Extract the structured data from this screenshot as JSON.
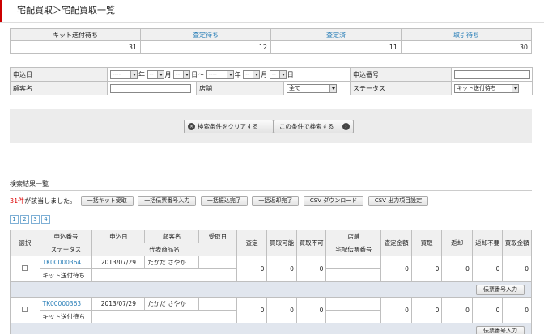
{
  "header": {
    "title": "宅配買取＞宅配買取一覧"
  },
  "summary": {
    "headers": [
      "キット送付待ち",
      "査定待ち",
      "査定済",
      "取引待ち"
    ],
    "counts": [
      "31",
      "12",
      "11",
      "30"
    ]
  },
  "search": {
    "apply_date_label": "申込日",
    "apply_no_label": "申込番号",
    "customer_label": "顧客名",
    "store_label": "店舗",
    "status_label": "ステータス",
    "date_from": {
      "year": "----",
      "month": "--",
      "day": "--"
    },
    "date_to": {
      "year": "----",
      "month": "--",
      "day": "--"
    },
    "unit_year": "年",
    "unit_month": "月",
    "unit_day": "日",
    "range_sep": "日〜",
    "store_value": "全て",
    "status_value": "キット送付待ち"
  },
  "buttons": {
    "clear": "検索条件をクリアする",
    "search": "この条件で検索する"
  },
  "results": {
    "section_title": "検索結果一覧",
    "count": "31件",
    "count_suffix": "が該当しました。",
    "action_buttons": [
      "一括キット受取",
      "一括伝票番号入力",
      "一括振込完了",
      "一括返却完了",
      "CSV ダウンロード",
      "CSV 出力項目設定"
    ],
    "pages": [
      "1",
      "2",
      "3",
      "4"
    ],
    "headers": {
      "select": "選択",
      "apply_no": "申込番号",
      "apply_date": "申込日",
      "customer": "顧客名",
      "received_date": "受取日",
      "status": "ステータス",
      "main_product": "代表商品名",
      "appraisal": "査定",
      "buyable": "買取可能",
      "not_buyable": "買取不可",
      "store": "店舗",
      "slip_no": "宅配伝票番号",
      "appraisal_amount": "査定金額",
      "purchase": "買取",
      "return": "返却",
      "return_unneeded": "返却不要",
      "purchase_amount": "買取金額"
    },
    "rows": [
      {
        "apply_no": "TK00000364",
        "apply_date": "2013/07/29",
        "customer": "たかだ さやか",
        "status": "キット送付待ち",
        "appraisal": "0",
        "buyable": "0",
        "not_buyable": "0",
        "appraisal_amount": "0",
        "purchase": "0",
        "return": "0",
        "return_unneeded": "0",
        "purchase_amount": "0"
      },
      {
        "apply_no": "TK00000363",
        "apply_date": "2013/07/29",
        "customer": "たかだ さやか",
        "status": "キット送付待ち",
        "appraisal": "0",
        "buyable": "0",
        "not_buyable": "0",
        "appraisal_amount": "0",
        "purchase": "0",
        "return": "0",
        "return_unneeded": "0",
        "purchase_amount": "0"
      }
    ],
    "slip_input_button": "伝票番号入力"
  },
  "colors": {
    "accent_red": "#cc0000",
    "link_blue": "#2a7fb8"
  }
}
